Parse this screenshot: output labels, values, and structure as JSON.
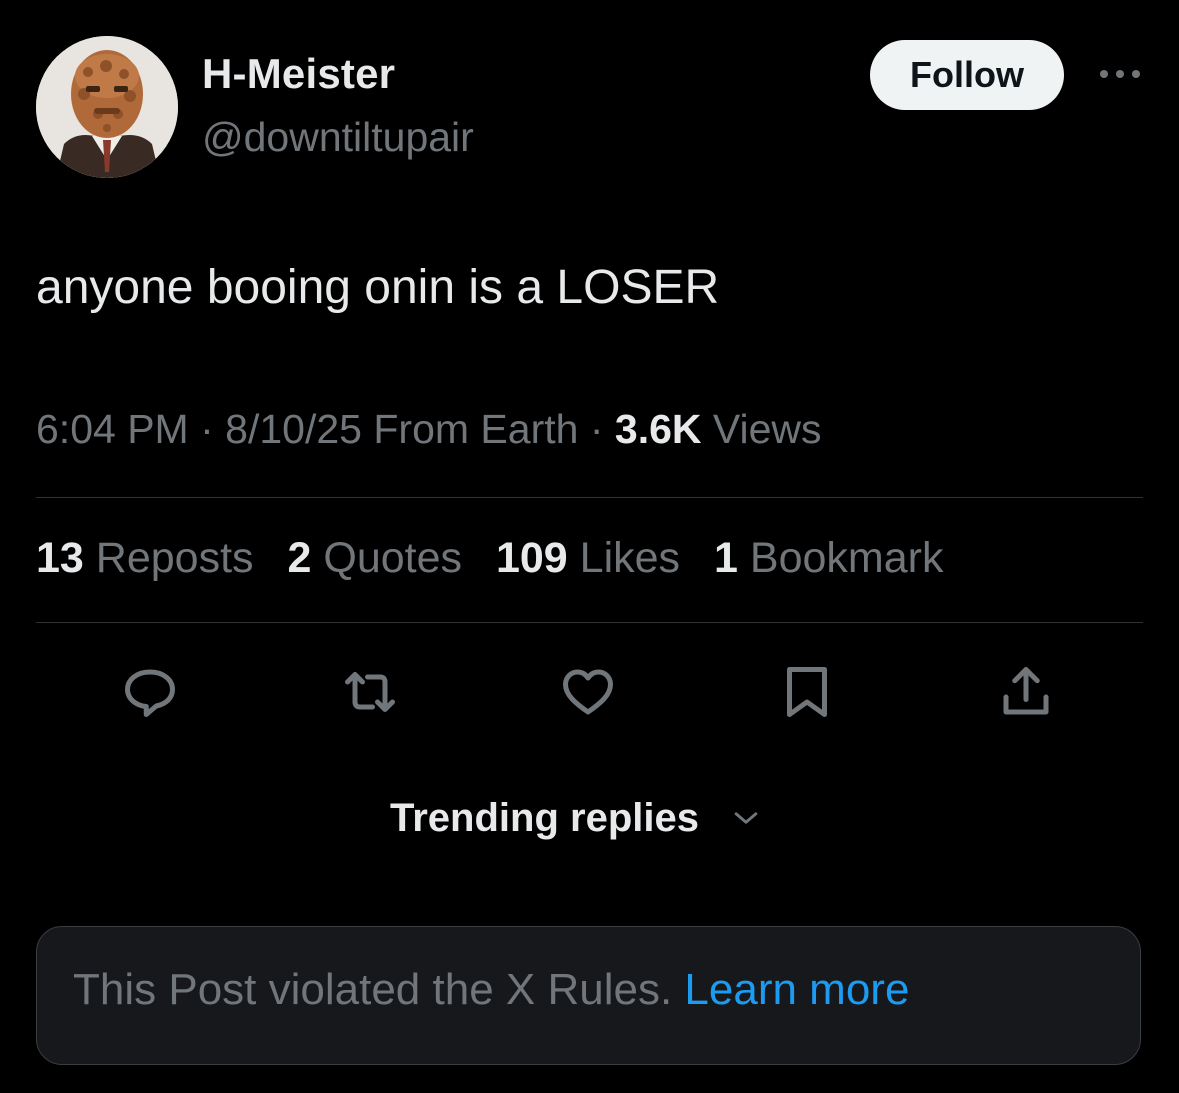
{
  "author": {
    "display_name": "H-Meister",
    "handle": "@downtiltupair"
  },
  "follow_label": "Follow",
  "post": {
    "text": "anyone booing onin is a LOSER",
    "time": "6:04 PM",
    "date": "8/10/25",
    "source": "From Earth",
    "views_count": "3.6K",
    "views_label": "Views",
    "separator": "·"
  },
  "stats": {
    "reposts": {
      "count": "13",
      "label": "Reposts"
    },
    "quotes": {
      "count": "2",
      "label": "Quotes"
    },
    "likes": {
      "count": "109",
      "label": "Likes"
    },
    "bookmarks": {
      "count": "1",
      "label": "Bookmark"
    }
  },
  "actions": [
    "reply-icon",
    "repost-icon",
    "like-icon",
    "bookmark-icon",
    "share-icon"
  ],
  "trending": {
    "label": "Trending replies"
  },
  "notice": {
    "text": "This Post violated the X Rules.",
    "link": "Learn more"
  },
  "colors": {
    "background": "#000000",
    "primary_text": "#e7e9ea",
    "secondary_text": "#71767b",
    "link": "#1d9bf0",
    "divider": "#2f3336",
    "follow_bg": "#eff3f4"
  }
}
